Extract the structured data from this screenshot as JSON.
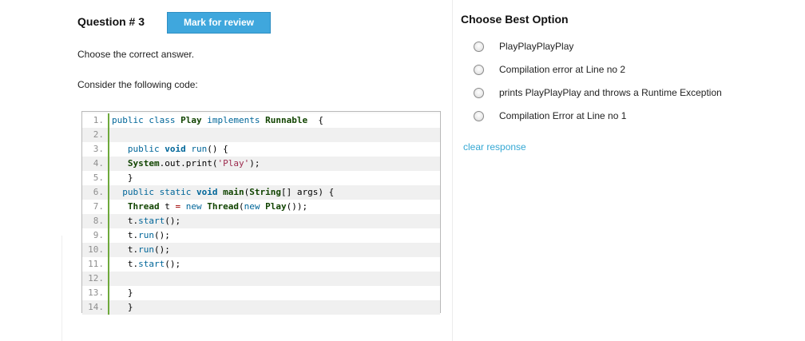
{
  "question": {
    "title": "Question # 3",
    "mark_for_review_label": "Mark for review",
    "instruction": "Choose the correct answer.",
    "prompt": "Consider the following code:"
  },
  "code_lines": [
    {
      "num": "1.",
      "tokens": [
        [
          "kw",
          "public "
        ],
        [
          "kw",
          "class "
        ],
        [
          "ty",
          "Play "
        ],
        [
          "kw",
          "implements "
        ],
        [
          "ty",
          "Runnable"
        ],
        [
          "",
          "  {"
        ]
      ]
    },
    {
      "num": "2.",
      "tokens": []
    },
    {
      "num": "3.",
      "tokens": [
        [
          "",
          "   "
        ],
        [
          "kw",
          "public "
        ],
        [
          "kb",
          "void "
        ],
        [
          "kw",
          "run"
        ],
        [
          "",
          "() {"
        ]
      ]
    },
    {
      "num": "4.",
      "tokens": [
        [
          "",
          "   "
        ],
        [
          "ty",
          "System"
        ],
        [
          "",
          ".out.print("
        ],
        [
          "st",
          "'Play'"
        ],
        [
          "",
          ");"
        ]
      ]
    },
    {
      "num": "5.",
      "tokens": [
        [
          "",
          "   }"
        ]
      ]
    },
    {
      "num": "6.",
      "tokens": [
        [
          "",
          "  "
        ],
        [
          "kw",
          "public "
        ],
        [
          "kw",
          "static "
        ],
        [
          "kb",
          "void "
        ],
        [
          "ty",
          "main"
        ],
        [
          "",
          "("
        ],
        [
          "ty",
          "String"
        ],
        [
          "",
          "[] args) {"
        ]
      ]
    },
    {
      "num": "7.",
      "tokens": [
        [
          "",
          "   "
        ],
        [
          "ty",
          "Thread "
        ],
        [
          "",
          "t "
        ],
        [
          "op",
          "= "
        ],
        [
          "kw",
          "new "
        ],
        [
          "ty",
          "Thread"
        ],
        [
          "",
          "("
        ],
        [
          "kw",
          "new "
        ],
        [
          "ty",
          "Play"
        ],
        [
          "",
          "());"
        ]
      ]
    },
    {
      "num": "8.",
      "tokens": [
        [
          "",
          "   t."
        ],
        [
          "kw",
          "start"
        ],
        [
          "",
          "();"
        ]
      ]
    },
    {
      "num": "9.",
      "tokens": [
        [
          "",
          "   t."
        ],
        [
          "kw",
          "run"
        ],
        [
          "",
          "();"
        ]
      ]
    },
    {
      "num": "10.",
      "tokens": [
        [
          "",
          "   t."
        ],
        [
          "kw",
          "run"
        ],
        [
          "",
          "();"
        ]
      ]
    },
    {
      "num": "11.",
      "tokens": [
        [
          "",
          "   t."
        ],
        [
          "kw",
          "start"
        ],
        [
          "",
          "();"
        ]
      ]
    },
    {
      "num": "12.",
      "tokens": []
    },
    {
      "num": "13.",
      "tokens": [
        [
          "",
          "   }"
        ]
      ]
    },
    {
      "num": "14.",
      "tokens": [
        [
          "",
          "   }"
        ]
      ]
    }
  ],
  "options_panel": {
    "title": "Choose Best Option",
    "options": [
      {
        "label": "PlayPlayPlayPlay",
        "selected": false
      },
      {
        "label": "Compilation error at Line no 2",
        "selected": false
      },
      {
        "label": "prints PlayPlayPlay and throws a Runtime Exception",
        "selected": false
      },
      {
        "label": "Compilation Error at Line no 1",
        "selected": false
      }
    ],
    "clear_label": "clear response"
  }
}
